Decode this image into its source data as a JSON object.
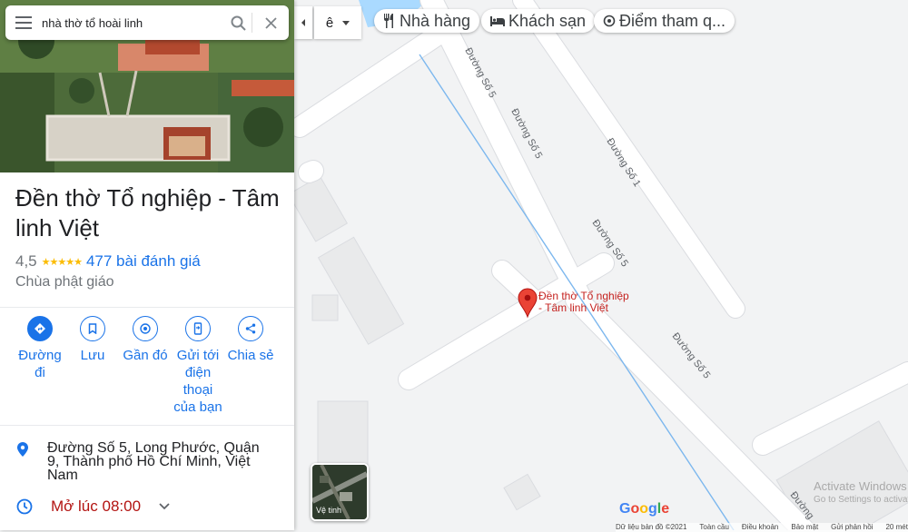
{
  "search": {
    "query": "nhà thờ tổ hoài linh"
  },
  "place": {
    "title": "Đền thờ Tổ nghiệp - Tâm linh Việt",
    "rating": "4,5",
    "stars": "★★★★★",
    "reviews": "477 bài đánh giá",
    "category": "Chùa phật giáo"
  },
  "actions": [
    {
      "label": "Đường đi",
      "icon": "directions-icon"
    },
    {
      "label": "Lưu",
      "icon": "bookmark-icon"
    },
    {
      "label": "Gần đó",
      "icon": "nearby-icon"
    },
    {
      "label": "Gửi tới điện thoại của bạn",
      "icon": "send-to-phone-icon"
    },
    {
      "label": "Chia sẻ",
      "icon": "share-icon"
    }
  ],
  "info": {
    "address": "Đường Số 5, Long Phước, Quận 9, Thành phố Hồ Chí Minh, Việt Nam",
    "hours": "Mở lúc 08:00"
  },
  "filters": [
    {
      "label": "Nhà hàng",
      "icon": "restaurant-icon"
    },
    {
      "label": "Khách sạn",
      "icon": "hotel-icon"
    },
    {
      "label": "Điểm tham q...",
      "icon": "attraction-icon"
    }
  ],
  "map": {
    "layer_select": "ê",
    "pin_label_line1": "Đền thờ Tổ nghiệp",
    "pin_label_line2": "- Tâm linh Việt",
    "road_labels": [
      "Đường Số 5",
      "Đường Số 5",
      "Đường Số 1",
      "Đường Số 5",
      "Đường Số 5",
      "Đường"
    ],
    "satellite_label": "Vệ tinh",
    "logo": "Google",
    "attribution": [
      "Dữ liệu bản đồ ©2021",
      "Toàn cầu",
      "Điều khoản",
      "Bảo mật",
      "Gửi phản hồi",
      "20 mét"
    ],
    "watermark_title": "Activate Windows",
    "watermark_sub": "Go to Settings to activate"
  },
  "colors": {
    "accent": "#1a73e8",
    "hours": "#b31412",
    "pin": "#ea4335",
    "road": "#ffffff",
    "map_bg": "#f2f3f4"
  }
}
